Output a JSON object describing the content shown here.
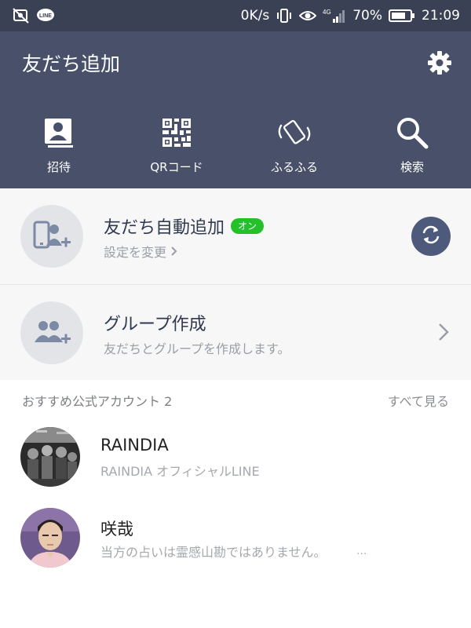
{
  "status_bar": {
    "left_icons": [
      "no-image-notification-icon",
      "line-notification-icon"
    ],
    "line_badge": "LINE",
    "speed": "0K/s",
    "network": "4G",
    "battery": "70%",
    "time": "21:09"
  },
  "header": {
    "title": "友だち追加",
    "settings_icon": "gear-icon",
    "actions": [
      {
        "label": "招待",
        "icon": "contact-card-icon"
      },
      {
        "label": "QRコード",
        "icon": "qr-code-icon"
      },
      {
        "label": "ふるふる",
        "icon": "shake-phone-icon"
      },
      {
        "label": "検索",
        "icon": "search-icon"
      }
    ]
  },
  "auto_add": {
    "title": "友だち自動追加",
    "badge": "オン",
    "subtitle": "設定を変更",
    "icon": "phone-add-friend-icon",
    "action_icon": "sync-icon"
  },
  "group_create": {
    "title": "グループ作成",
    "subtitle": "友だちとグループを作成します。",
    "icon": "group-add-icon"
  },
  "recommended": {
    "header": "おすすめ公式アカウント 2",
    "see_all": "すべて見る",
    "accounts": [
      {
        "name": "RAINDIA",
        "description": "RAINDIA オフィシャルLINE",
        "more": ""
      },
      {
        "name": "咲哉",
        "description": "当方の占いは霊感山勘ではありません。",
        "more": "..."
      }
    ]
  },
  "colors": {
    "status_bar": "#3a4154",
    "header": "#485169",
    "badge_on": "#23c02a",
    "sync_button": "#4e5a7c"
  }
}
